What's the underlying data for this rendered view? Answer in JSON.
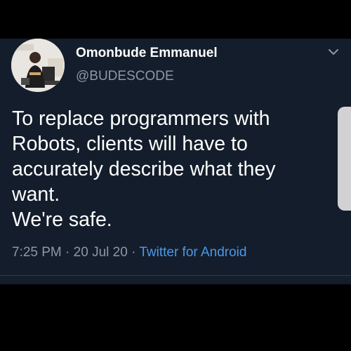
{
  "tweet": {
    "display_name": "Omonbude Emmanuel",
    "handle": "@BUDESCODE",
    "text": "To replace programmers with\nRobots, clients will have to\naccurately describe what they\nwant.\nWe're safe.",
    "time": "7:25 PM",
    "separator_1": "·",
    "date": "20 Jul 20",
    "separator_2": "·",
    "source": "Twitter for Android"
  },
  "icons": {
    "menu": "chevron-down-icon",
    "avatar": "profile-photo"
  },
  "colors": {
    "background": "#000000",
    "card": "#141d2b",
    "text_primary": "#ffffff",
    "text_secondary": "#8b98a5",
    "link": "#4a99e9"
  }
}
